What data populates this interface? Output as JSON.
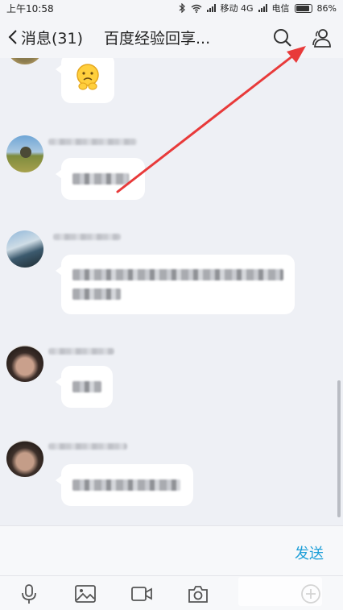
{
  "status_bar": {
    "time": "上午10:58",
    "carrier1": "移动 4G",
    "carrier2": "电信",
    "battery": "86%"
  },
  "header": {
    "back_label": "消息(31)",
    "title": "百度经验回享..."
  },
  "input": {
    "send_label": "发送"
  },
  "colors": {
    "accent": "#1e9fd8",
    "annotation_arrow": "#e83a3a"
  },
  "icons": {
    "header": [
      "search-icon",
      "group-members-icon"
    ],
    "toolbar": [
      "microphone-icon",
      "image-icon",
      "video-icon",
      "camera-icon",
      "plus-icon"
    ]
  }
}
